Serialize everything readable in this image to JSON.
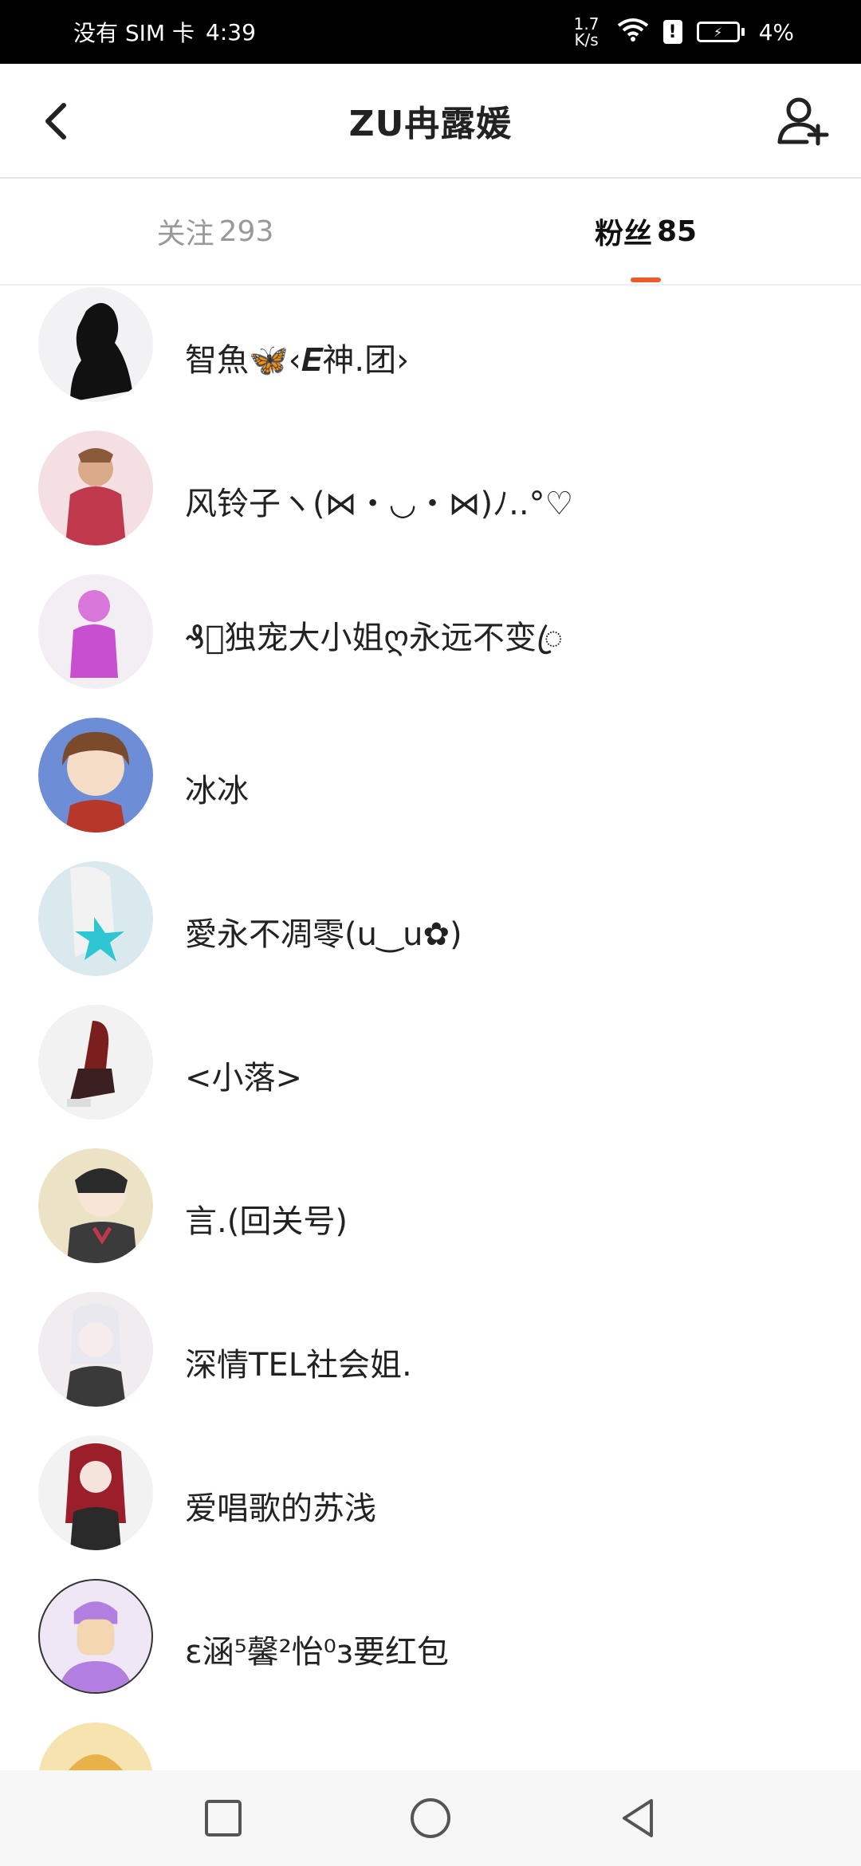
{
  "status_bar": {
    "carrier": "没有 SIM 卡",
    "time": "4:39",
    "net_speed_value": "1.7",
    "net_speed_unit": "K/s",
    "battery": "4%"
  },
  "header": {
    "title": "ZU冉露媛",
    "back_icon": "chevron-left-icon",
    "add_icon": "add-user-icon"
  },
  "tabs": [
    {
      "label": "关注",
      "count": "293",
      "active": false
    },
    {
      "label": "粉丝",
      "count": "85",
      "active": true
    }
  ],
  "accent_color": "#ef5a2a",
  "fans": [
    {
      "name": "智魚🦋‹𝑬神.团›",
      "avatar_bg": "#f2f2f4",
      "avatar_fg": "#111111"
    },
    {
      "name": "风铃子ヽ(⋈・◡・⋈)ﾉ..°♡",
      "avatar_bg": "#f4dfe3",
      "avatar_fg": "#c0384b"
    },
    {
      "name": "₰ꦿ独宠大小姐ღ永远不变ꦿ",
      "avatar_bg": "#f3eef3",
      "avatar_fg": "#c84fcf"
    },
    {
      "name": "冰冰",
      "avatar_bg": "#6d8ed6",
      "avatar_fg": "#7a4a2a"
    },
    {
      "name": "愛永不凋零(u‿u✿)",
      "avatar_bg": "#d9e9ee",
      "avatar_fg": "#2fc6d3"
    },
    {
      "name": "<小落>",
      "avatar_bg": "#f2f2f2",
      "avatar_fg": "#7a1e1e"
    },
    {
      "name": "言.(回关号)",
      "avatar_bg": "#ece3c7",
      "avatar_fg": "#2a2a2a"
    },
    {
      "name": "深情TEL社会姐.",
      "avatar_bg": "#f1ecef",
      "avatar_fg": "#3a3a3a"
    },
    {
      "name": "爱唱歌的苏浅",
      "avatar_bg": "#f2f2f2",
      "avatar_fg": "#9a1f2a"
    },
    {
      "name": "ε涵⁵馨²怡⁰з要红包",
      "avatar_bg": "#efe6f6",
      "avatar_fg": "#b27fe0"
    },
    {
      "name": "",
      "avatar_bg": "#f7e3b0",
      "avatar_fg": "#e8b24a"
    }
  ],
  "nav": {
    "recents_icon": "square-icon",
    "home_icon": "circle-icon",
    "back_icon": "triangle-back-icon"
  }
}
